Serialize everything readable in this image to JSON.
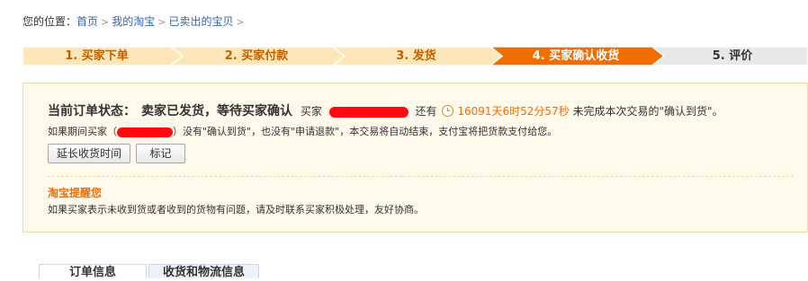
{
  "breadcrumb": {
    "label": "您的位置：",
    "items": [
      "首页",
      "我的淘宝",
      "已卖出的宝贝"
    ],
    "separator": ">"
  },
  "steps": [
    {
      "label": "1. 买家下单",
      "state": "done"
    },
    {
      "label": "2. 买家付款",
      "state": "done"
    },
    {
      "label": "3. 发货",
      "state": "done"
    },
    {
      "label": "4. 买家确认收货",
      "state": "current"
    },
    {
      "label": "5. 评价",
      "state": "pending"
    }
  ],
  "colors": {
    "done_fill": "#fde7b8",
    "done_text": "#c35f00",
    "current_fill": "#f26d00",
    "current_text": "#ffffff",
    "pending_fill": "#e8e8e8",
    "pending_text": "#333333",
    "link": "#3366aa",
    "highlight": "#f26d00"
  },
  "status": {
    "title": "当前订单状态：",
    "text": "卖家已发货，等待买家确认",
    "buyer_label": "买家",
    "still": "还有",
    "countdown": "16091天6时52分57秒",
    "suffix": "未完成本次交易的\"确认到货\"。",
    "line2_prefix": "如果期间买家（",
    "line2_suffix": "）没有\"确认到货\"，也没有\"申请退款\"，本交易将自动结束，支付宝将把货款支付给您。",
    "extend_button": "延长收货时间",
    "mark_button": "标记",
    "remind_title": "淘宝提醒您",
    "remind_text": "如果买家表示未收到货或者收到的货物有问题，请及时联系买家积极处理，友好协商。"
  },
  "tabs": [
    {
      "label": "订单信息",
      "active": true
    },
    {
      "label": "收货和物流信息",
      "active": false
    }
  ]
}
